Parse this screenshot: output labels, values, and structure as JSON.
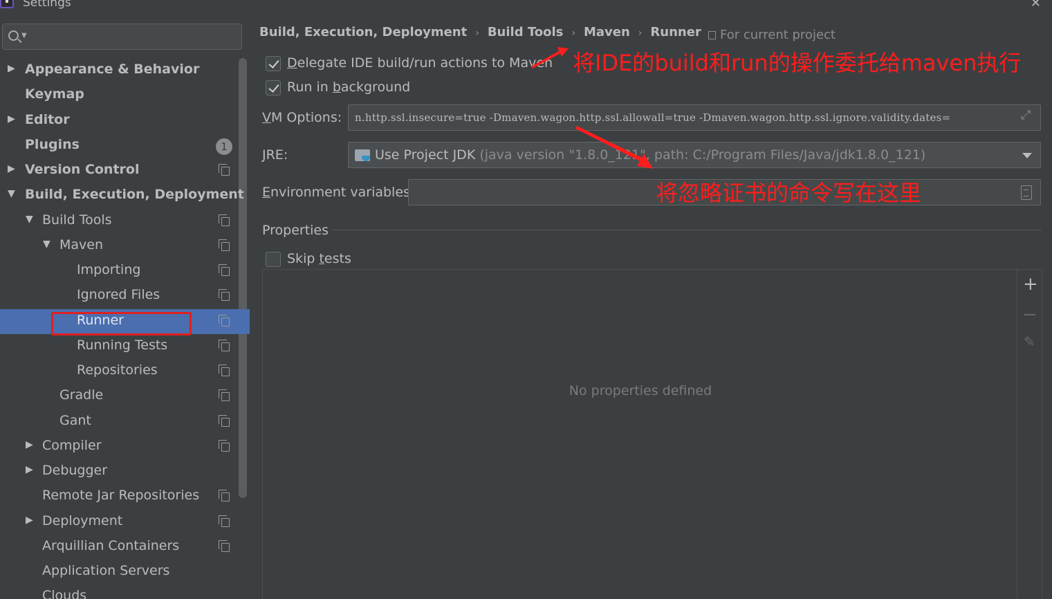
{
  "window": {
    "title": "Settings"
  },
  "search": {
    "value": ""
  },
  "sidebar": {
    "items": [
      {
        "label": "Appearance & Behavior",
        "has_arrow": true,
        "expanded": false
      },
      {
        "label": "Keymap"
      },
      {
        "label": "Editor",
        "has_arrow": true,
        "expanded": false
      },
      {
        "label": "Plugins",
        "badge": "1"
      },
      {
        "label": "Version Control",
        "has_arrow": true,
        "expanded": false
      },
      {
        "label": "Build, Execution, Deployment",
        "has_arrow": true,
        "expanded": true
      },
      {
        "label": "Build Tools",
        "has_arrow": true,
        "expanded": true
      },
      {
        "label": "Maven",
        "has_arrow": true,
        "expanded": true
      },
      {
        "label": "Importing"
      },
      {
        "label": "Ignored Files"
      },
      {
        "label": "Runner",
        "selected": true
      },
      {
        "label": "Running Tests"
      },
      {
        "label": "Repositories"
      },
      {
        "label": "Gradle"
      },
      {
        "label": "Gant"
      },
      {
        "label": "Compiler",
        "has_arrow": true,
        "expanded": false
      },
      {
        "label": "Debugger",
        "has_arrow": true,
        "expanded": false
      },
      {
        "label": "Remote Jar Repositories"
      },
      {
        "label": "Deployment",
        "has_arrow": true,
        "expanded": false
      },
      {
        "label": "Arquillian Containers"
      },
      {
        "label": "Application Servers"
      },
      {
        "label": "Clouds"
      }
    ]
  },
  "breadcrumb": [
    "Build, Execution, Deployment",
    "Build Tools",
    "Maven",
    "Runner"
  ],
  "breadcrumb_separator": "›",
  "scope_label": "For current project",
  "options": {
    "delegate": {
      "label_first": "D",
      "label_rest": "elegate IDE build/run actions to Maven",
      "checked": true
    },
    "background": {
      "label_before": "Run in ",
      "label_u": "b",
      "label_after": "ackground",
      "checked": true
    }
  },
  "vm_options": {
    "label_u": "V",
    "label_rest": "M Options:",
    "value": "n.http.ssl.insecure=true -Dmaven.wagon.http.ssl.allowall=true -Dmaven.wagon.http.ssl.ignore.validity.dates="
  },
  "jre": {
    "label_u": "J",
    "label_rest": "RE:",
    "value_main": "Use Project JDK",
    "value_detail": " (java version \"1.8.0_121\", path: C:/Program Files/Java/jdk1.8.0_121)"
  },
  "env": {
    "label_u": "E",
    "label_rest": "nvironment variables:",
    "value": ""
  },
  "properties": {
    "title": "Properties",
    "skip_tests": {
      "label_before": "Skip ",
      "label_u": "t",
      "label_after": "ests",
      "checked": false
    },
    "empty_text": "No properties defined",
    "add_symbol": "+",
    "edit_symbol": "✎"
  },
  "annotations": {
    "delegate_note": "将IDE的build和run的操作委托给maven执行",
    "vm_note": "将忽略证书的命令写在这里",
    "color": "#ff1d1d"
  },
  "colors": {
    "selected": "#4b6eaf",
    "background": "#3c3f41"
  }
}
